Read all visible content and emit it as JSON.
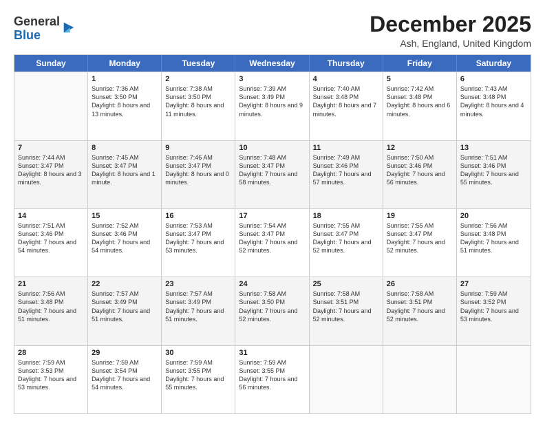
{
  "logo": {
    "general": "General",
    "blue": "Blue"
  },
  "header": {
    "month": "December 2025",
    "location": "Ash, England, United Kingdom"
  },
  "days": [
    "Sunday",
    "Monday",
    "Tuesday",
    "Wednesday",
    "Thursday",
    "Friday",
    "Saturday"
  ],
  "rows": [
    [
      {
        "day": "",
        "sunrise": "",
        "sunset": "",
        "daylight": ""
      },
      {
        "day": "1",
        "sunrise": "Sunrise: 7:36 AM",
        "sunset": "Sunset: 3:50 PM",
        "daylight": "Daylight: 8 hours and 13 minutes."
      },
      {
        "day": "2",
        "sunrise": "Sunrise: 7:38 AM",
        "sunset": "Sunset: 3:50 PM",
        "daylight": "Daylight: 8 hours and 11 minutes."
      },
      {
        "day": "3",
        "sunrise": "Sunrise: 7:39 AM",
        "sunset": "Sunset: 3:49 PM",
        "daylight": "Daylight: 8 hours and 9 minutes."
      },
      {
        "day": "4",
        "sunrise": "Sunrise: 7:40 AM",
        "sunset": "Sunset: 3:48 PM",
        "daylight": "Daylight: 8 hours and 7 minutes."
      },
      {
        "day": "5",
        "sunrise": "Sunrise: 7:42 AM",
        "sunset": "Sunset: 3:48 PM",
        "daylight": "Daylight: 8 hours and 6 minutes."
      },
      {
        "day": "6",
        "sunrise": "Sunrise: 7:43 AM",
        "sunset": "Sunset: 3:48 PM",
        "daylight": "Daylight: 8 hours and 4 minutes."
      }
    ],
    [
      {
        "day": "7",
        "sunrise": "Sunrise: 7:44 AM",
        "sunset": "Sunset: 3:47 PM",
        "daylight": "Daylight: 8 hours and 3 minutes."
      },
      {
        "day": "8",
        "sunrise": "Sunrise: 7:45 AM",
        "sunset": "Sunset: 3:47 PM",
        "daylight": "Daylight: 8 hours and 1 minute."
      },
      {
        "day": "9",
        "sunrise": "Sunrise: 7:46 AM",
        "sunset": "Sunset: 3:47 PM",
        "daylight": "Daylight: 8 hours and 0 minutes."
      },
      {
        "day": "10",
        "sunrise": "Sunrise: 7:48 AM",
        "sunset": "Sunset: 3:47 PM",
        "daylight": "Daylight: 7 hours and 58 minutes."
      },
      {
        "day": "11",
        "sunrise": "Sunrise: 7:49 AM",
        "sunset": "Sunset: 3:46 PM",
        "daylight": "Daylight: 7 hours and 57 minutes."
      },
      {
        "day": "12",
        "sunrise": "Sunrise: 7:50 AM",
        "sunset": "Sunset: 3:46 PM",
        "daylight": "Daylight: 7 hours and 56 minutes."
      },
      {
        "day": "13",
        "sunrise": "Sunrise: 7:51 AM",
        "sunset": "Sunset: 3:46 PM",
        "daylight": "Daylight: 7 hours and 55 minutes."
      }
    ],
    [
      {
        "day": "14",
        "sunrise": "Sunrise: 7:51 AM",
        "sunset": "Sunset: 3:46 PM",
        "daylight": "Daylight: 7 hours and 54 minutes."
      },
      {
        "day": "15",
        "sunrise": "Sunrise: 7:52 AM",
        "sunset": "Sunset: 3:46 PM",
        "daylight": "Daylight: 7 hours and 54 minutes."
      },
      {
        "day": "16",
        "sunrise": "Sunrise: 7:53 AM",
        "sunset": "Sunset: 3:47 PM",
        "daylight": "Daylight: 7 hours and 53 minutes."
      },
      {
        "day": "17",
        "sunrise": "Sunrise: 7:54 AM",
        "sunset": "Sunset: 3:47 PM",
        "daylight": "Daylight: 7 hours and 52 minutes."
      },
      {
        "day": "18",
        "sunrise": "Sunrise: 7:55 AM",
        "sunset": "Sunset: 3:47 PM",
        "daylight": "Daylight: 7 hours and 52 minutes."
      },
      {
        "day": "19",
        "sunrise": "Sunrise: 7:55 AM",
        "sunset": "Sunset: 3:47 PM",
        "daylight": "Daylight: 7 hours and 52 minutes."
      },
      {
        "day": "20",
        "sunrise": "Sunrise: 7:56 AM",
        "sunset": "Sunset: 3:48 PM",
        "daylight": "Daylight: 7 hours and 51 minutes."
      }
    ],
    [
      {
        "day": "21",
        "sunrise": "Sunrise: 7:56 AM",
        "sunset": "Sunset: 3:48 PM",
        "daylight": "Daylight: 7 hours and 51 minutes."
      },
      {
        "day": "22",
        "sunrise": "Sunrise: 7:57 AM",
        "sunset": "Sunset: 3:49 PM",
        "daylight": "Daylight: 7 hours and 51 minutes."
      },
      {
        "day": "23",
        "sunrise": "Sunrise: 7:57 AM",
        "sunset": "Sunset: 3:49 PM",
        "daylight": "Daylight: 7 hours and 51 minutes."
      },
      {
        "day": "24",
        "sunrise": "Sunrise: 7:58 AM",
        "sunset": "Sunset: 3:50 PM",
        "daylight": "Daylight: 7 hours and 52 minutes."
      },
      {
        "day": "25",
        "sunrise": "Sunrise: 7:58 AM",
        "sunset": "Sunset: 3:51 PM",
        "daylight": "Daylight: 7 hours and 52 minutes."
      },
      {
        "day": "26",
        "sunrise": "Sunrise: 7:58 AM",
        "sunset": "Sunset: 3:51 PM",
        "daylight": "Daylight: 7 hours and 52 minutes."
      },
      {
        "day": "27",
        "sunrise": "Sunrise: 7:59 AM",
        "sunset": "Sunset: 3:52 PM",
        "daylight": "Daylight: 7 hours and 53 minutes."
      }
    ],
    [
      {
        "day": "28",
        "sunrise": "Sunrise: 7:59 AM",
        "sunset": "Sunset: 3:53 PM",
        "daylight": "Daylight: 7 hours and 53 minutes."
      },
      {
        "day": "29",
        "sunrise": "Sunrise: 7:59 AM",
        "sunset": "Sunset: 3:54 PM",
        "daylight": "Daylight: 7 hours and 54 minutes."
      },
      {
        "day": "30",
        "sunrise": "Sunrise: 7:59 AM",
        "sunset": "Sunset: 3:55 PM",
        "daylight": "Daylight: 7 hours and 55 minutes."
      },
      {
        "day": "31",
        "sunrise": "Sunrise: 7:59 AM",
        "sunset": "Sunset: 3:55 PM",
        "daylight": "Daylight: 7 hours and 56 minutes."
      },
      {
        "day": "",
        "sunrise": "",
        "sunset": "",
        "daylight": ""
      },
      {
        "day": "",
        "sunrise": "",
        "sunset": "",
        "daylight": ""
      },
      {
        "day": "",
        "sunrise": "",
        "sunset": "",
        "daylight": ""
      }
    ]
  ]
}
